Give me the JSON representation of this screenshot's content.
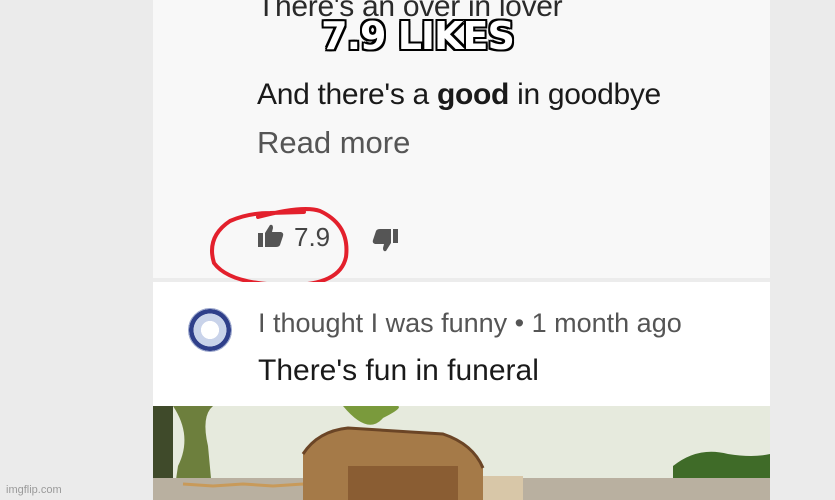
{
  "caption": "7.9 LIKES",
  "comment_top": {
    "line1": "There's an over in lover",
    "line2_before": "And there's a ",
    "line2_bold": "good",
    "line2_after": " in goodbye",
    "read_more": "Read more",
    "like_count": "7.9"
  },
  "comment_bottom": {
    "meta": "I thought I was funny • 1 month ago",
    "text": "There's fun in funeral"
  },
  "watermark": "imgflip.com",
  "colors": {
    "annotation": "#e3202c",
    "caption_fill": "#ffffff",
    "caption_stroke": "#000000"
  }
}
